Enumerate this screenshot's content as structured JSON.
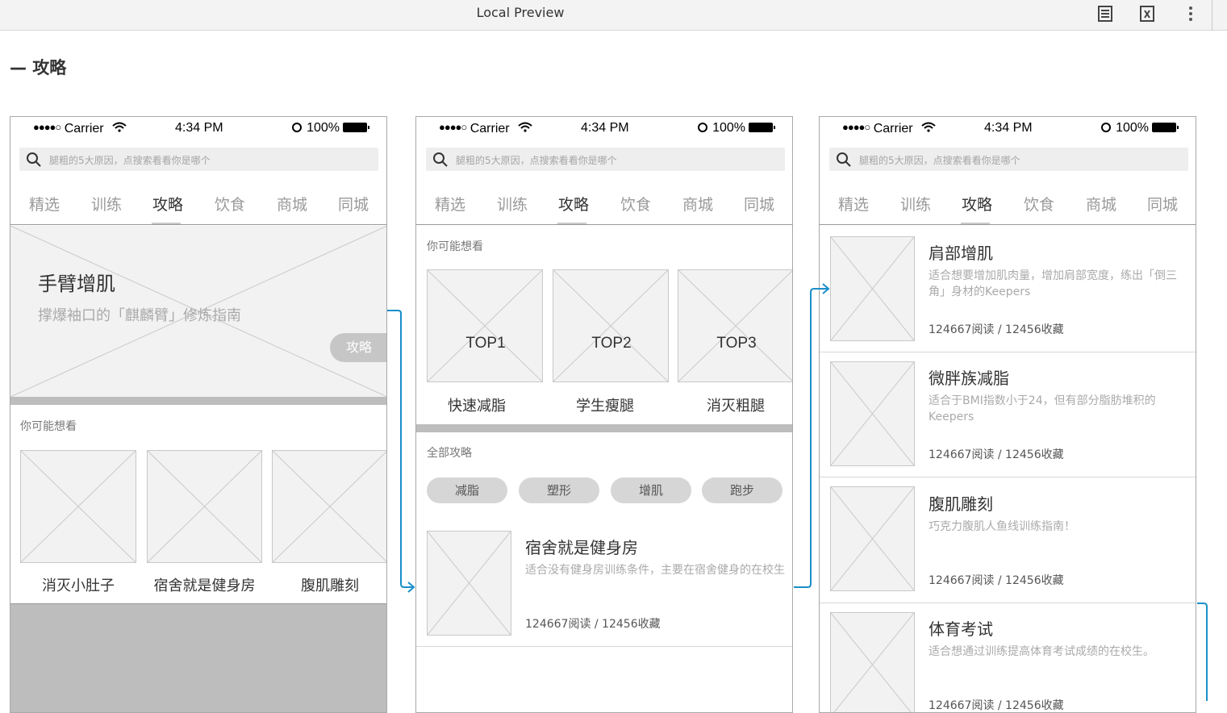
{
  "window": {
    "title": "Local Preview"
  },
  "section": {
    "title": "— 攻略"
  },
  "status": {
    "carrier": "Carrier",
    "time": "4:34 PM",
    "battery": "100%"
  },
  "search": {
    "placeholder": "腿粗的5大原因，点搜索看看你是哪个"
  },
  "tabs": [
    "精选",
    "训练",
    "攻略",
    "饮食",
    "商城",
    "同城"
  ],
  "screen1": {
    "hero": {
      "title": "手臂增肌",
      "subtitle": "撑爆袖口的「麒麟臂」修炼指南",
      "button": "攻略"
    },
    "maybe_title": "你可能想看",
    "thumbs": [
      "消灭小肚子",
      "宿舍就是健身房",
      "腹肌雕刻"
    ]
  },
  "screen2": {
    "maybe_title": "你可能想看",
    "tops": [
      {
        "badge": "TOP1",
        "label": "快速减脂"
      },
      {
        "badge": "TOP2",
        "label": "学生瘦腿"
      },
      {
        "badge": "TOP3",
        "label": "消灭粗腿"
      }
    ],
    "all_title": "全部攻略",
    "chips": [
      "减脂",
      "塑形",
      "增肌",
      "跑步"
    ],
    "item": {
      "title": "宿舍就是健身房",
      "desc": "适合没有健身房训练条件，主要在宿舍健身的在校生",
      "stats": "124667阅读 / 12456收藏"
    }
  },
  "screen3": {
    "items": [
      {
        "title": "肩部增肌",
        "desc": "适合想要增加肌肉量，增加肩部宽度，练出「倒三角」身材的Keepers",
        "stats": "124667阅读 / 12456收藏"
      },
      {
        "title": "微胖族减脂",
        "desc": "适合于BMI指数小于24，但有部分脂肪堆积的Keepers",
        "stats": "124667阅读 / 12456收藏"
      },
      {
        "title": "腹肌雕刻",
        "desc": "巧克力腹肌人鱼线训练指南！",
        "stats": "124667阅读 / 12456收藏"
      },
      {
        "title": "体育考试",
        "desc": "适合想通过训练提高体育考试成绩的在校生。",
        "stats": "124667阅读 / 12456收藏"
      }
    ]
  },
  "colors": {
    "connector": "#1a8fc9",
    "placeholder_bg": "#f2f2f2",
    "divider": "#bdbdbd"
  },
  "icons": [
    "document-icon",
    "code-icon",
    "more-icon",
    "search-icon",
    "wifi-icon",
    "battery-icon",
    "lock-rotation-icon"
  ]
}
